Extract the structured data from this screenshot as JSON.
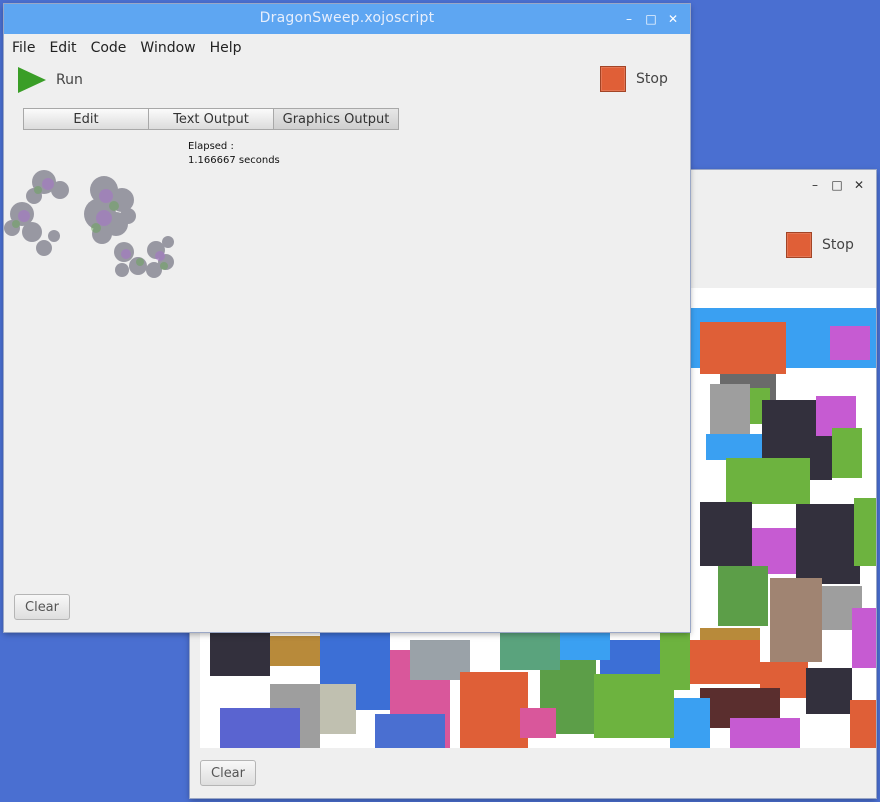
{
  "back_window": {
    "stop_label": "Stop",
    "clear_label": "Clear",
    "controls": {
      "minimize": "–",
      "maximize": "□",
      "close": "✕"
    }
  },
  "front_window": {
    "title": "DragonSweep.xojoscript",
    "controls": {
      "minimize": "–",
      "maximize": "□",
      "close": "✕"
    },
    "menu": [
      "File",
      "Edit",
      "Code",
      "Window",
      "Help"
    ],
    "run_label": "Run",
    "stop_label": "Stop",
    "tabs": [
      "Edit",
      "Text Output",
      "Graphics Output"
    ],
    "elapsed_label": "Elapsed :",
    "elapsed_value": "1.166667 seconds",
    "clear_label": "Clear"
  },
  "colors": {
    "desktop": "#4a6fd1",
    "titlebar_active": "#5ea6f2",
    "stop": "#e05f37",
    "run": "#3a9e27"
  },
  "icons": [
    "play-icon",
    "stop-icon",
    "minimize-icon",
    "maximize-icon",
    "close-icon"
  ]
}
